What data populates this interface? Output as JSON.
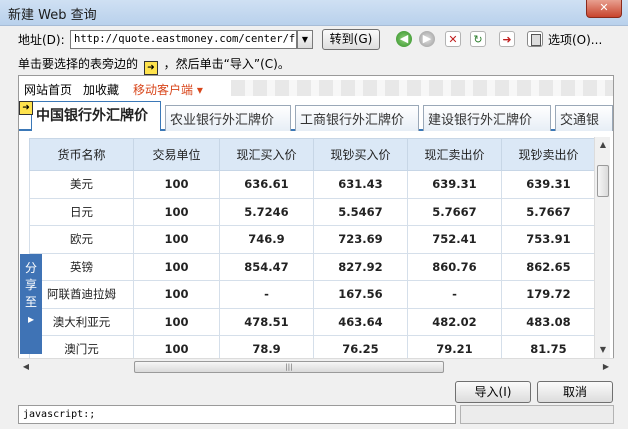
{
  "window": {
    "title": "新建 Web 查询",
    "close_glyph": "✕"
  },
  "toolbar": {
    "address_label": "地址(D):",
    "address_value": "http://quote.eastmoney.com/center/for",
    "goto_label": "转到(G)",
    "options_label": "选项(O)..."
  },
  "hint": {
    "before": "单击要选择的表旁边的",
    "after": "，然后单击“导入”(C)。"
  },
  "site_nav": {
    "home": "网站首页",
    "favorite": "加收藏",
    "mobile": "移动客户端"
  },
  "tabs": [
    "中国银行外汇牌价",
    "农业银行外汇牌价",
    "工商银行外汇牌价",
    "建设银行外汇牌价",
    "交通银"
  ],
  "table": {
    "headers": [
      "货币名称",
      "交易单位",
      "现汇买入价",
      "现钞买入价",
      "现汇卖出价",
      "现钞卖出价"
    ],
    "rows": [
      [
        "美元",
        "100",
        "636.61",
        "631.43",
        "639.31",
        "639.31"
      ],
      [
        "日元",
        "100",
        "5.7246",
        "5.5467",
        "5.7667",
        "5.7667"
      ],
      [
        "欧元",
        "100",
        "746.9",
        "723.69",
        "752.41",
        "753.91"
      ],
      [
        "英镑",
        "100",
        "854.47",
        "827.92",
        "860.76",
        "862.65"
      ],
      [
        "阿联酋迪拉姆",
        "100",
        "-",
        "167.56",
        "-",
        "179.72"
      ],
      [
        "澳大利亚元",
        "100",
        "478.51",
        "463.64",
        "482.02",
        "483.08"
      ],
      [
        "澳门元",
        "100",
        "78.9",
        "76.25",
        "79.21",
        "81.75"
      ]
    ]
  },
  "share": [
    "分",
    "享",
    "至",
    "▸"
  ],
  "status": {
    "text": "javascript:;"
  },
  "buttons": {
    "import": "导入(I)",
    "cancel": "取消"
  },
  "icons": {
    "back": "back-icon",
    "forward": "forward-icon",
    "stop": "stop-icon",
    "refresh": "refresh-icon",
    "import_select": "select-table-icon",
    "options": "options-icon"
  }
}
